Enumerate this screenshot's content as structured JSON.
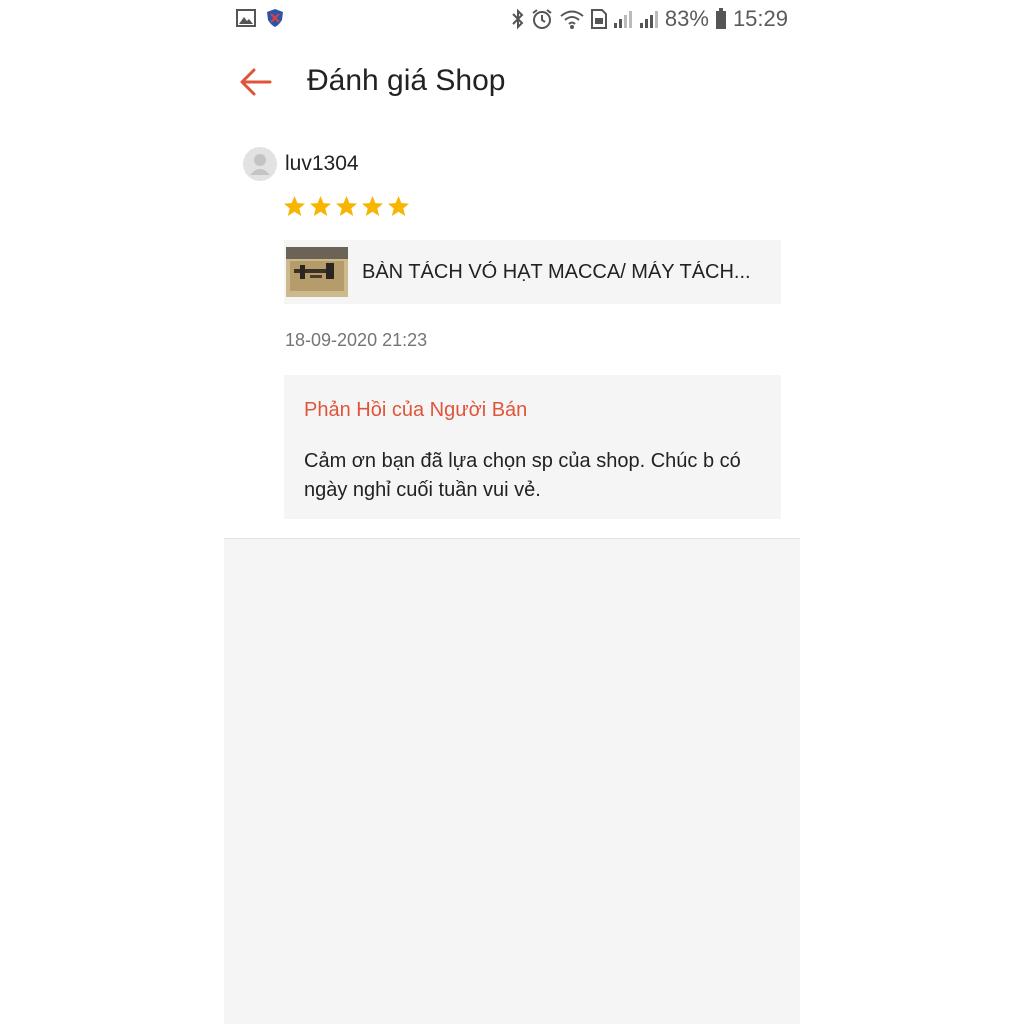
{
  "status_bar": {
    "battery": "83%",
    "time": "15:29",
    "icons": [
      "gallery-icon",
      "shield-icon",
      "bluetooth-icon",
      "alarm-icon",
      "wifi-icon",
      "sim-icon",
      "signal-icon",
      "signal-icon",
      "battery-icon"
    ]
  },
  "app_bar": {
    "back_icon": "arrow-left-icon",
    "title": "Đánh giá Shop"
  },
  "review": {
    "username": "luv1304",
    "rating": 5,
    "product_name": "BÀN TÁCH VỎ HẠT MACCA/ MÁY TÁCH...",
    "date": "18-09-2020 21:23",
    "seller_reply": {
      "title": "Phản Hồi của Người Bán",
      "text": "Cảm ơn bạn đã lựa chọn sp của shop. Chúc b có ngày nghỉ cuối tuần vui vẻ."
    }
  },
  "colors": {
    "accent": "#e0553a",
    "star": "#f7b500",
    "card_bg": "#f5f5f5"
  }
}
